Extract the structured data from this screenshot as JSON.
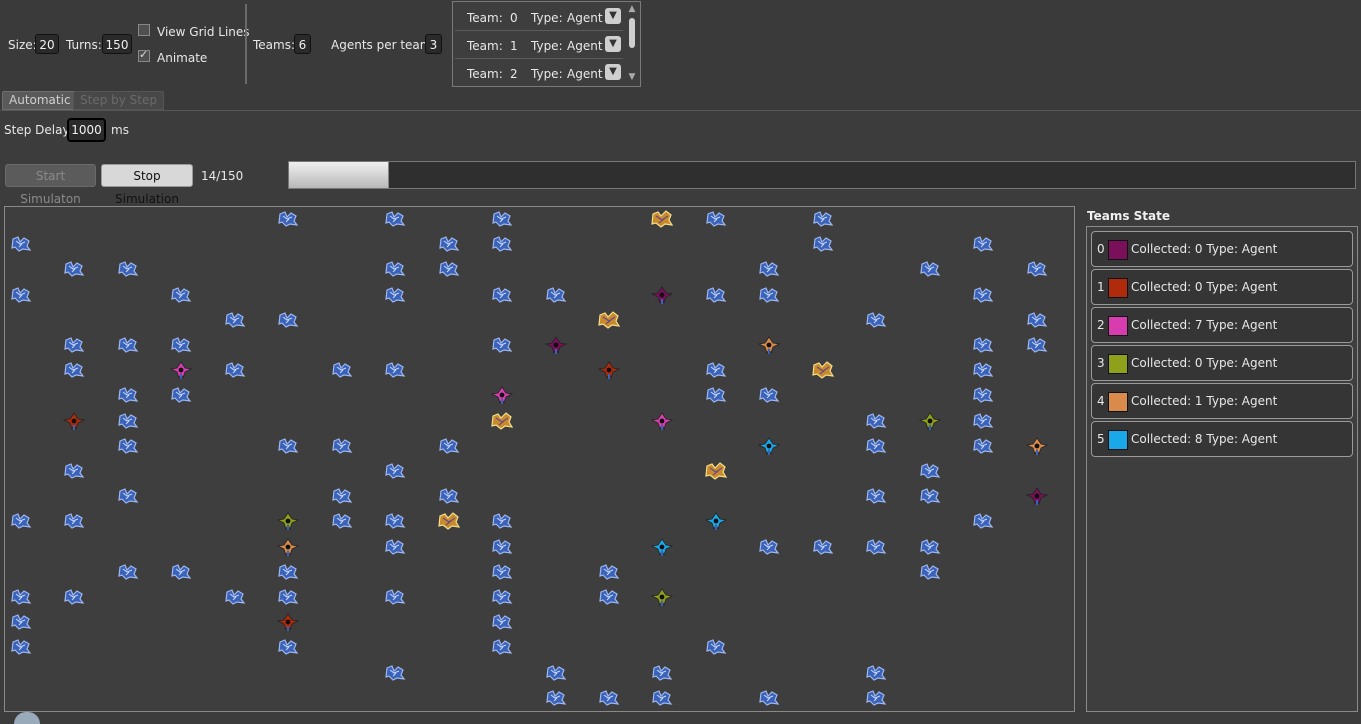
{
  "toolbar": {
    "size_label": "Size:",
    "size_value": "20",
    "turns_label": "Turns:",
    "turns_value": "150",
    "view_grid_lines_label": "View Grid Lines",
    "view_grid_lines_checked": false,
    "animate_label": "Animate",
    "animate_checked": true,
    "teams_label": "Teams:",
    "teams_value": "6",
    "agents_label": "Agents per team:",
    "agents_value": "3"
  },
  "team_config": [
    {
      "team_label": "Team:",
      "team_id": "0",
      "type_label": "Type:",
      "type_value": "Agent"
    },
    {
      "team_label": "Team:",
      "team_id": "1",
      "type_label": "Type:",
      "type_value": "Agent"
    },
    {
      "team_label": "Team:",
      "team_id": "2",
      "type_label": "Type:",
      "type_value": "Agent"
    }
  ],
  "tabs": {
    "automatic": "Automatic",
    "step_by_step": "Step by Step"
  },
  "controls": {
    "step_delay_label": "Step Delay:",
    "step_delay_value": "1000",
    "step_delay_unit": "ms",
    "start_label": "Start Simulaton",
    "stop_label": "Stop Simulation",
    "progress_text": "14/150",
    "progress_fraction": 0.0933
  },
  "teams_state": {
    "title": "Teams State",
    "teams": [
      {
        "index": "0",
        "color": "#7a0f5a",
        "info": "Collected: 0 Type: Agent"
      },
      {
        "index": "1",
        "color": "#b02a0c",
        "info": "Collected: 0 Type: Agent"
      },
      {
        "index": "2",
        "color": "#d83db0",
        "info": "Collected: 7 Type: Agent"
      },
      {
        "index": "3",
        "color": "#8fa01a",
        "info": "Collected: 0 Type: Agent"
      },
      {
        "index": "4",
        "color": "#d88b4a",
        "info": "Collected: 1 Type: Agent"
      },
      {
        "index": "5",
        "color": "#1aa8e8",
        "info": "Collected: 8 Type: Agent"
      }
    ]
  },
  "grid": {
    "size": 20,
    "resources": [
      [
        5,
        0
      ],
      [
        7,
        0
      ],
      [
        9,
        0
      ],
      [
        13,
        0
      ],
      [
        15,
        0
      ],
      [
        0,
        1
      ],
      [
        8,
        1
      ],
      [
        9,
        1
      ],
      [
        15,
        1
      ],
      [
        18,
        1
      ],
      [
        1,
        2
      ],
      [
        2,
        2
      ],
      [
        7,
        2
      ],
      [
        8,
        2
      ],
      [
        14,
        2
      ],
      [
        17,
        2
      ],
      [
        19,
        2
      ],
      [
        0,
        3
      ],
      [
        3,
        3
      ],
      [
        7,
        3
      ],
      [
        9,
        3
      ],
      [
        10,
        3
      ],
      [
        13,
        3
      ],
      [
        14,
        3
      ],
      [
        18,
        3
      ],
      [
        4,
        4
      ],
      [
        5,
        4
      ],
      [
        16,
        4
      ],
      [
        19,
        4
      ],
      [
        1,
        5
      ],
      [
        2,
        5
      ],
      [
        3,
        5
      ],
      [
        9,
        5
      ],
      [
        18,
        5
      ],
      [
        19,
        5
      ],
      [
        1,
        6
      ],
      [
        4,
        6
      ],
      [
        6,
        6
      ],
      [
        7,
        6
      ],
      [
        13,
        6
      ],
      [
        18,
        6
      ],
      [
        2,
        7
      ],
      [
        3,
        7
      ],
      [
        13,
        7
      ],
      [
        14,
        7
      ],
      [
        18,
        7
      ],
      [
        2,
        8
      ],
      [
        16,
        8
      ],
      [
        18,
        8
      ],
      [
        2,
        9
      ],
      [
        5,
        9
      ],
      [
        6,
        9
      ],
      [
        8,
        9
      ],
      [
        16,
        9
      ],
      [
        18,
        9
      ],
      [
        1,
        10
      ],
      [
        7,
        10
      ],
      [
        17,
        10
      ],
      [
        2,
        11
      ],
      [
        6,
        11
      ],
      [
        8,
        11
      ],
      [
        16,
        11
      ],
      [
        17,
        11
      ],
      [
        0,
        12
      ],
      [
        1,
        12
      ],
      [
        6,
        12
      ],
      [
        7,
        12
      ],
      [
        9,
        12
      ],
      [
        18,
        12
      ],
      [
        7,
        13
      ],
      [
        9,
        13
      ],
      [
        14,
        13
      ],
      [
        15,
        13
      ],
      [
        16,
        13
      ],
      [
        17,
        13
      ],
      [
        2,
        14
      ],
      [
        3,
        14
      ],
      [
        5,
        14
      ],
      [
        9,
        14
      ],
      [
        11,
        14
      ],
      [
        17,
        14
      ],
      [
        0,
        15
      ],
      [
        1,
        15
      ],
      [
        4,
        15
      ],
      [
        5,
        15
      ],
      [
        7,
        15
      ],
      [
        9,
        15
      ],
      [
        11,
        15
      ],
      [
        0,
        16
      ],
      [
        9,
        16
      ],
      [
        0,
        17
      ],
      [
        5,
        17
      ],
      [
        9,
        17
      ],
      [
        13,
        17
      ],
      [
        7,
        18
      ],
      [
        10,
        18
      ],
      [
        12,
        18
      ],
      [
        16,
        18
      ],
      [
        10,
        19
      ],
      [
        11,
        19
      ],
      [
        12,
        19
      ],
      [
        14,
        19
      ],
      [
        16,
        19
      ]
    ],
    "gold": [
      [
        12,
        0
      ],
      [
        11,
        4
      ],
      [
        15,
        6
      ],
      [
        9,
        8
      ],
      [
        13,
        10
      ],
      [
        8,
        12
      ]
    ],
    "agents": [
      {
        "team": 0,
        "cell": [
          12,
          3
        ]
      },
      {
        "team": 0,
        "cell": [
          10,
          5
        ]
      },
      {
        "team": 0,
        "cell": [
          19,
          11
        ]
      },
      {
        "team": 1,
        "cell": [
          11,
          6
        ]
      },
      {
        "team": 1,
        "cell": [
          1,
          8
        ]
      },
      {
        "team": 1,
        "cell": [
          5,
          16
        ]
      },
      {
        "team": 2,
        "cell": [
          3,
          6
        ]
      },
      {
        "team": 2,
        "cell": [
          9,
          7
        ]
      },
      {
        "team": 2,
        "cell": [
          12,
          8
        ]
      },
      {
        "team": 3,
        "cell": [
          17,
          8
        ]
      },
      {
        "team": 3,
        "cell": [
          5,
          12
        ]
      },
      {
        "team": 3,
        "cell": [
          12,
          15
        ]
      },
      {
        "team": 4,
        "cell": [
          14,
          5
        ]
      },
      {
        "team": 4,
        "cell": [
          19,
          9
        ]
      },
      {
        "team": 4,
        "cell": [
          5,
          13
        ]
      },
      {
        "team": 5,
        "cell": [
          14,
          9
        ]
      },
      {
        "team": 5,
        "cell": [
          13,
          12
        ]
      },
      {
        "team": 5,
        "cell": [
          12,
          13
        ]
      }
    ]
  }
}
